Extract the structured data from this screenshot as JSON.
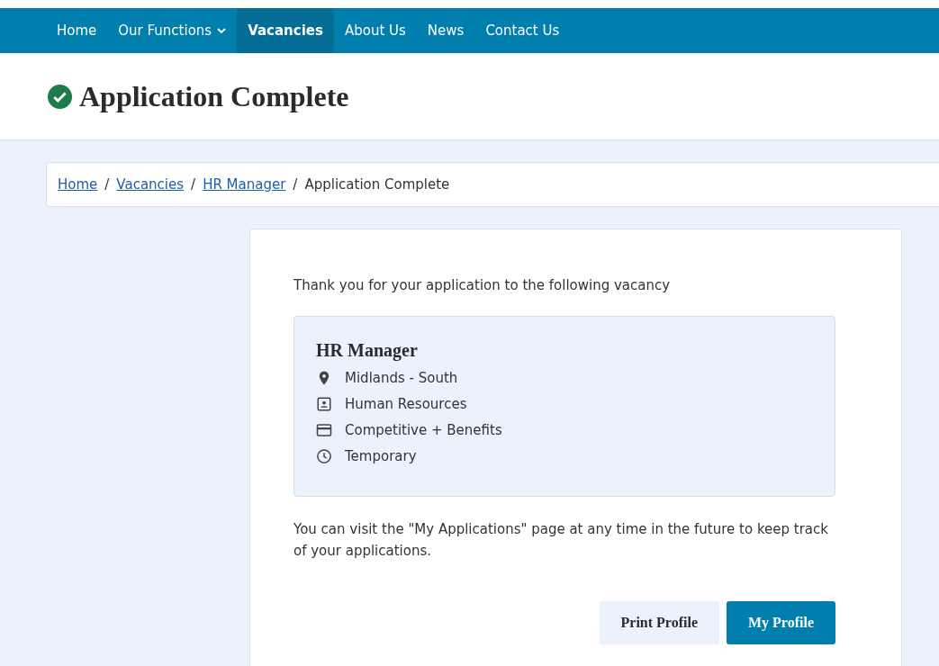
{
  "nav": {
    "items": [
      {
        "label": "Home",
        "selected": false,
        "dropdown": false
      },
      {
        "label": "Our Functions",
        "selected": false,
        "dropdown": true
      },
      {
        "label": "Vacancies",
        "selected": true,
        "dropdown": false
      },
      {
        "label": "About Us",
        "selected": false,
        "dropdown": false
      },
      {
        "label": "News",
        "selected": false,
        "dropdown": false
      },
      {
        "label": "Contact Us",
        "selected": false,
        "dropdown": false
      }
    ]
  },
  "page_title": "Application Complete",
  "breadcrumb": {
    "separator": "/",
    "items": [
      {
        "label": "Home",
        "kind": "link"
      },
      {
        "label": "Vacancies",
        "kind": "link"
      },
      {
        "label": "HR Manager",
        "kind": "link"
      },
      {
        "label": "Application Complete",
        "kind": "current"
      }
    ]
  },
  "intro": "Thank you for your application to the following vacancy",
  "vacancy": {
    "title": "HR Manager",
    "details": [
      {
        "kind": "location",
        "text": "Midlands - South"
      },
      {
        "kind": "department",
        "text": "Human Resources"
      },
      {
        "kind": "salary",
        "text": "Competitive + Benefits"
      },
      {
        "kind": "contract",
        "text": "Temporary"
      }
    ]
  },
  "note": "You can visit the \"My Applications\" page at any time in the future to keep track of your applications.",
  "buttons": [
    {
      "label": "Print Profile",
      "kind": "secondary"
    },
    {
      "label": "My Profile",
      "kind": "primary"
    }
  ]
}
